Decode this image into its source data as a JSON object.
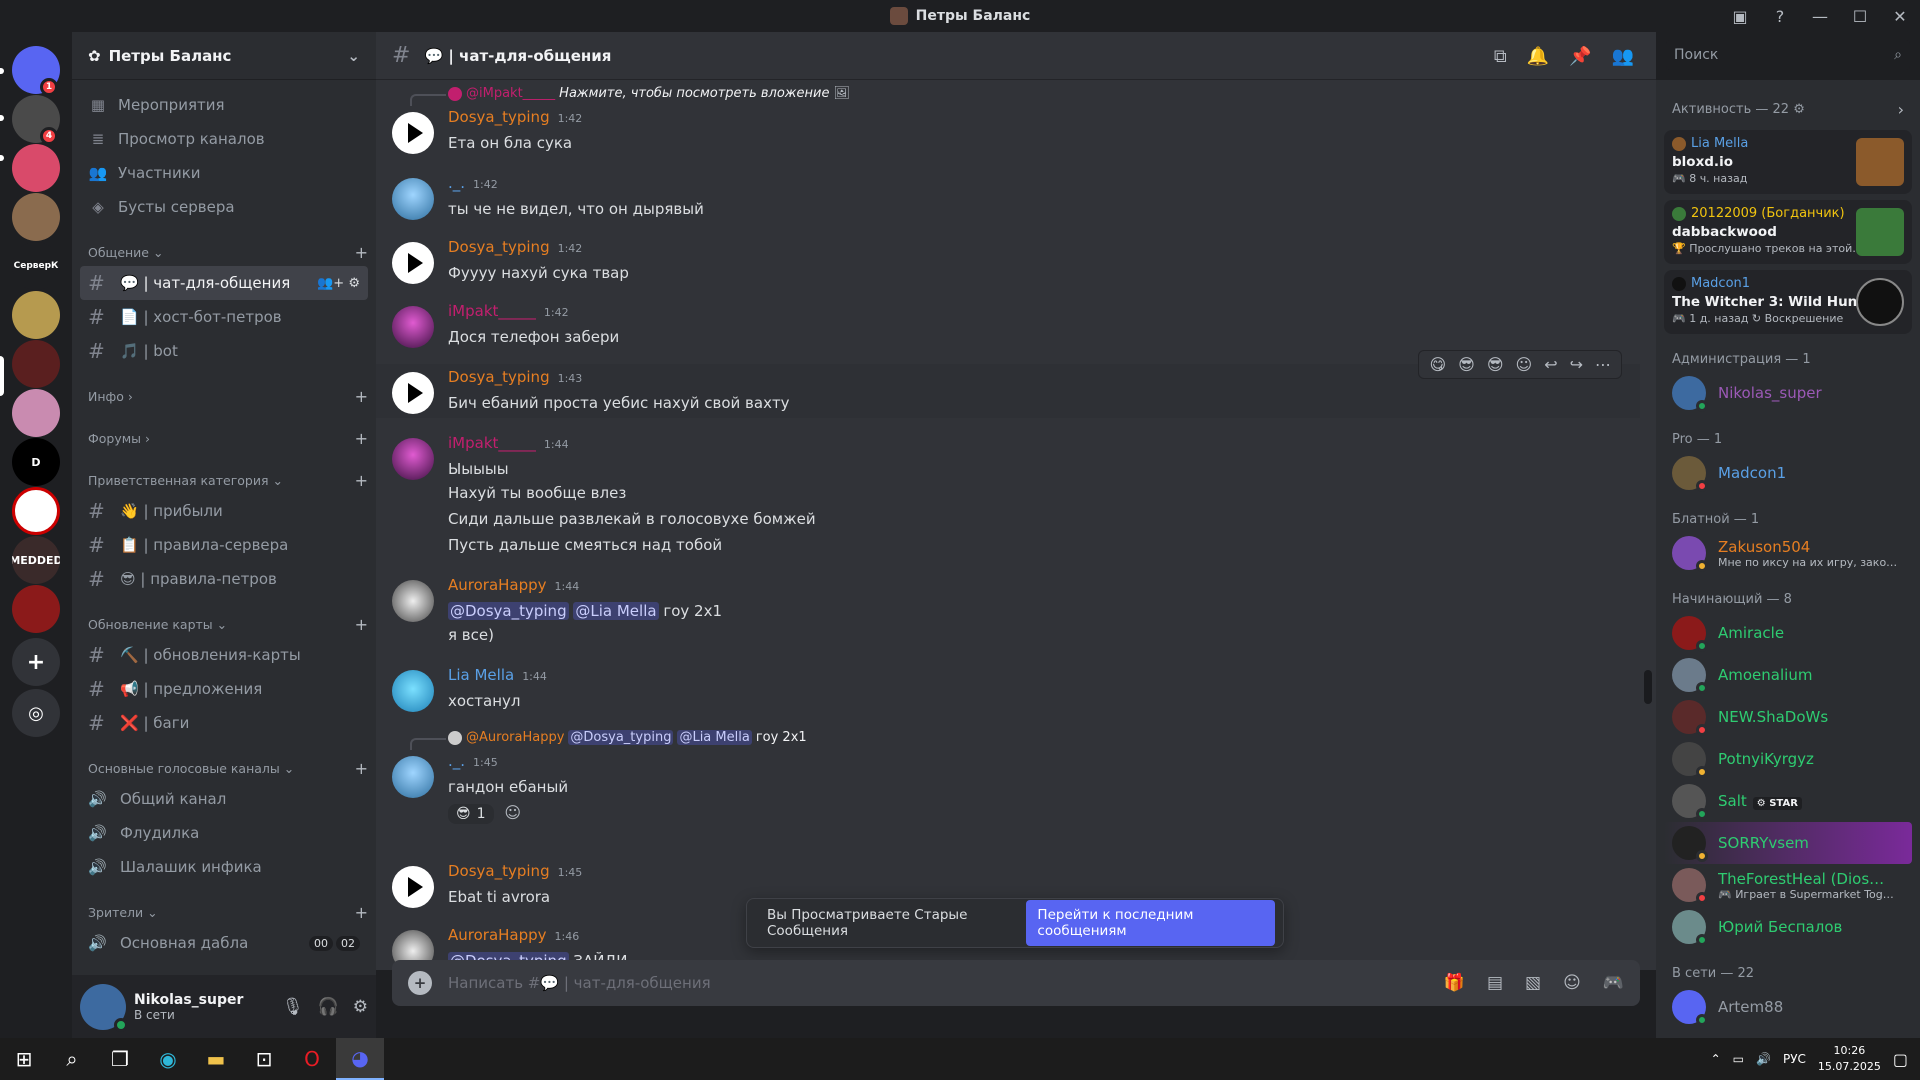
{
  "window": {
    "title": "Петры Баланс"
  },
  "guilds": [
    {
      "label": "",
      "color": "#5865f2",
      "badge": "1"
    },
    {
      "label": "",
      "color": "#4a4a4a",
      "badge": "4"
    },
    {
      "label": "",
      "color": "#d94a6a",
      "badge": ""
    },
    {
      "label": "",
      "color": "#8a6b4e",
      "badge": ""
    },
    {
      "label": "СерверК",
      "color": "#1e1f22",
      "badge": ""
    },
    {
      "label": "",
      "color": "#b69a4f",
      "badge": ""
    },
    {
      "label": "",
      "color": "#5a1f1f",
      "badge": ""
    },
    {
      "label": "",
      "color": "#c98bb0",
      "badge": ""
    },
    {
      "label": "D",
      "color": "#000000",
      "badge": ""
    },
    {
      "label": "",
      "color": "#ffffff",
      "badge": ""
    },
    {
      "label": "MEDDED",
      "color": "#3a2a2a",
      "badge": ""
    },
    {
      "label": "",
      "color": "#8b1a1a",
      "badge": ""
    }
  ],
  "server": {
    "name": "Петры Баланс"
  },
  "sidebar_links": [
    {
      "icon": "calendar-icon",
      "glyph": "▦",
      "label": "Мероприятия"
    },
    {
      "icon": "browse-channels-icon",
      "glyph": "≣",
      "label": "Просмотр каналов"
    },
    {
      "icon": "members-icon",
      "glyph": "👥",
      "label": "Участники"
    },
    {
      "icon": "boost-icon",
      "glyph": "◈",
      "label": "Бусты сервера"
    }
  ],
  "categories": {
    "general": "Общение",
    "info": "Инфо",
    "forums": "Форумы",
    "welcome": "Приветственная категория",
    "map_updates": "Обновление карты",
    "voice": "Основные голосовые каналы",
    "viewers": "Зрители"
  },
  "channels": {
    "general": [
      {
        "label": "💬 | чат-для-общения",
        "active": true
      },
      {
        "label": "📄 | хост-бот-петров",
        "active": false
      },
      {
        "label": "🎵 | bot",
        "active": false
      }
    ],
    "welcome": [
      {
        "label": "👋 | прибыли"
      },
      {
        "label": "📋 | правила-сервера"
      },
      {
        "label": "😎 | правила-петров"
      }
    ],
    "map_updates": [
      {
        "label": "⛏️ | обновления-карты"
      },
      {
        "label": "📢 | предложения"
      },
      {
        "label": "❌ | баги"
      }
    ],
    "voice": [
      {
        "label": "Общий канал"
      },
      {
        "label": "Флудилка"
      },
      {
        "label": "Шалашик инфика"
      }
    ],
    "viewers": [
      {
        "label": "Основная дабла",
        "count_a": "00",
        "count_b": "02"
      }
    ]
  },
  "user": {
    "name": "Nikolas_super",
    "status": "В сети"
  },
  "chat_header": {
    "title": "💬 | чат-для-общения"
  },
  "search": {
    "placeholder": "Поиск"
  },
  "messages": {
    "reply1": {
      "name": "@iMpakt_____",
      "text": "Нажмите, чтобы посмотреть вложение"
    },
    "m1": {
      "name": "Dosya_typing",
      "time": "1:42",
      "text": "Ета он бла сука"
    },
    "m2": {
      "name": "._.",
      "time": "1:42",
      "text": "ты че не видел, что он дырявый"
    },
    "m3": {
      "name": "Dosya_typing",
      "time": "1:42",
      "text": "Фуууу нахуй сука твар"
    },
    "m4": {
      "name": "iMpakt_____",
      "time": "1:42",
      "text": "Дося телефон забери"
    },
    "m5": {
      "name": "Dosya_typing",
      "time": "1:43",
      "text": "Бич ебаний проста уебис нахуй свой вахту"
    },
    "m6": {
      "name": "iMpakt_____",
      "time": "1:44",
      "lines": [
        "Ыыыыы",
        "Нахуй ты вообще влез",
        "Сиди дальше развлекай в голосовухе бомжей",
        "Пусть дальше смеяться над тобой"
      ]
    },
    "m7": {
      "name": "AuroraHappy",
      "time": "1:44",
      "mention1": "@Dosya_typing",
      "mention2": "@Lia Mella",
      "text": "гоу 2x1",
      "line2": "я все)"
    },
    "m8": {
      "name": "Lia Mella",
      "time": "1:44",
      "text": "хостанул"
    },
    "reply2": {
      "name": "@AuroraHappy",
      "mention1": "@Dosya_typing",
      "mention2": "@Lia Mella",
      "text": "гоу 2x1"
    },
    "m9": {
      "name": "._.",
      "time": "1:45",
      "text": "гандон ебаный",
      "reaction_count": "1"
    },
    "m10": {
      "name": "Dosya_typing",
      "time": "1:45",
      "text": "Ebat ti avrora"
    },
    "m11": {
      "name": "AuroraHappy",
      "time": "1:46",
      "mention": "@Dosya_typing",
      "text": "ЗАЙДИ"
    }
  },
  "toast": {
    "text": "Вы Просматриваете Старые Сообщения",
    "button": "Перейти к последним сообщениям"
  },
  "composer": {
    "placeholder": "Написать #💬 | чат-для-общения"
  },
  "members_panel": {
    "activity_header": "Активность — 22",
    "activity": [
      {
        "name": "Lia Mella",
        "name_color": "#5aa0e6",
        "game": "bloxd.io",
        "sub": "🎮 8 ч. назад",
        "thumb": "#8b5a2b"
      },
      {
        "name": "20122009 (Богданчик)",
        "name_color": "#f1c40f",
        "game": "dabbackwood",
        "sub": "🏆 Прослушано треков на этой…",
        "thumb": "#3a7a3a"
      },
      {
        "name": "Madcon1",
        "name_color": "#5aa0e6",
        "game": "The Witcher 3: Wild Hunt",
        "sub": "🎮 1 д. назад  ↻ Воскрешение",
        "thumb": "#111111"
      }
    ],
    "groups": [
      {
        "title": "Администрация — 1",
        "members": [
          {
            "name": "Nikolas_super",
            "color": "#9b59b6",
            "sub": "",
            "status": "#23a55a",
            "avatar": "#3d6aa0",
            "tag": ""
          }
        ]
      },
      {
        "title": "Pro — 1",
        "members": [
          {
            "name": "Madcon1",
            "color": "#5aa0e6",
            "sub": "",
            "status": "#f23f43",
            "avatar": "#6b5a3a",
            "tag": ""
          }
        ]
      },
      {
        "title": "Блатной — 1",
        "members": [
          {
            "name": "Zakuson504",
            "color": "#e67e22",
            "sub": "Мне по иксу на их игру, зако…",
            "status": "#f0b232",
            "avatar": "#7a4ab0",
            "tag": ""
          }
        ]
      },
      {
        "title": "Начинающий — 8",
        "members": [
          {
            "name": "Amiracle",
            "color": "#2ecc71",
            "sub": "",
            "status": "#23a55a",
            "avatar": "#8b1a1a",
            "tag": ""
          },
          {
            "name": "Amoenalium",
            "color": "#2ecc71",
            "sub": "",
            "status": "#23a55a",
            "avatar": "#6b7b8b",
            "tag": ""
          },
          {
            "name": "NEW.ShaDoWs",
            "color": "#2ecc71",
            "sub": "",
            "status": "#f23f43",
            "avatar": "#5a2a2a",
            "tag": ""
          },
          {
            "name": "PotnyiKyrgyz",
            "color": "#2ecc71",
            "sub": "",
            "status": "#f0b232",
            "avatar": "#444444",
            "tag": ""
          },
          {
            "name": "Salt",
            "color": "#2ecc71",
            "sub": "",
            "status": "#23a55a",
            "avatar": "#555555",
            "tag": "⚙ STAR"
          },
          {
            "name": "SORRYvsem",
            "color": "#2ecc71",
            "sub": "",
            "status": "#f0b232",
            "avatar": "#222222",
            "tag": ""
          },
          {
            "name": "TheForestHeal (Dios…",
            "color": "#2ecc71",
            "sub": "🎮 Играет в Supermarket Tog…",
            "status": "#f23f43",
            "avatar": "#7a5a5a",
            "tag": ""
          },
          {
            "name": "Юрий Беспалов",
            "color": "#2ecc71",
            "sub": "",
            "status": "#23a55a",
            "avatar": "#6b8b8b",
            "tag": ""
          }
        ]
      },
      {
        "title": "В сети — 22",
        "members": [
          {
            "name": "Artem88",
            "color": "#949ba4",
            "sub": "",
            "status": "#23a55a",
            "avatar": "#5865f2",
            "tag": ""
          }
        ]
      }
    ]
  },
  "taskbar": {
    "lang": "РУС",
    "time": "10:26",
    "date": "15.07.2025"
  }
}
